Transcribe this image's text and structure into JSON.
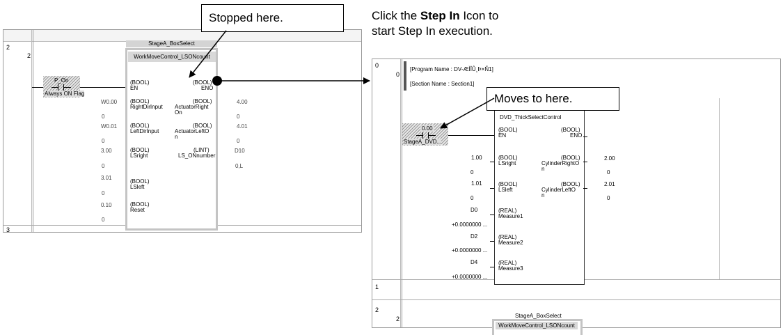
{
  "callouts": {
    "stopped": "Stopped here.",
    "moves": "Moves to here.",
    "instruction_line1_pre": "Click the ",
    "instruction_line1_bold": "Step In",
    "instruction_line1_post": " Icon to",
    "instruction_line2": "start Step In execution."
  },
  "left_panel": {
    "rung_num_outer": "2",
    "rung_num_inner": "2",
    "rung_next": "3",
    "fb_instance": "StageA_BoxSelect",
    "fb_name": "WorkMoveControl_LSONcount",
    "contact_label": "P_On",
    "contact_comment": "Always ON Flag",
    "en_type": "(BOOL)",
    "en_name": "EN",
    "eno_type": "(BOOL)",
    "eno_name": "ENO",
    "inputs": [
      {
        "addr": "W0.00",
        "val": "0",
        "type": "(BOOL)",
        "name": "RightDirInput"
      },
      {
        "addr": "W0.01",
        "val": "0",
        "type": "(BOOL)",
        "name": "LeftDirInput"
      },
      {
        "addr": "3.00",
        "val": "0",
        "type": "(BOOL)",
        "name": "LSright"
      },
      {
        "addr": "3.01",
        "val": "0",
        "type": "(BOOL)",
        "name": "LSleft"
      },
      {
        "addr": "0.10",
        "val": "0",
        "type": "(BOOL)",
        "name": "Reset"
      }
    ],
    "outputs": [
      {
        "type": "(BOOL)",
        "name1": "ActuatorRight",
        "name2": "On",
        "addr": "4.00",
        "val": "0"
      },
      {
        "type": "(BOOL)",
        "name1": "ActuatorLeftO",
        "name2": "n",
        "addr": "4.01",
        "val": "0"
      },
      {
        "type": "(LINT)",
        "name1": "LS_ONnumber",
        "name2": "",
        "addr": "D10",
        "val": "0,L"
      }
    ]
  },
  "right_panel": {
    "row0_outer": "0",
    "row0_inner": "0",
    "program_name": "[Program Name : DV-ÆÌÎÛ¸Þ×Ñ1]",
    "section_name": "[Section Name : Section1]",
    "fb_name": "DVD_ThickSelectControl",
    "contact_addr": "0.00",
    "contact_comment": "StageA_DVD...",
    "en_type": "(BOOL)",
    "en_name": "EN",
    "eno_type": "(BOOL)",
    "eno_name": "ENO",
    "inputs": [
      {
        "addr": "1.00",
        "val": "0",
        "type": "(BOOL)",
        "name": "LSright"
      },
      {
        "addr": "1.01",
        "val": "0",
        "type": "(BOOL)",
        "name": "LSleft"
      },
      {
        "addr": "D0",
        "val": "+0.0000000 ...",
        "type": "(REAL)",
        "name": "Measure1"
      },
      {
        "addr": "D2",
        "val": "+0.0000000 ...",
        "type": "(REAL)",
        "name": "Measure2"
      },
      {
        "addr": "D4",
        "val": "+0.0000000 ...",
        "type": "(REAL)",
        "name": "Measure3"
      }
    ],
    "outputs": [
      {
        "type": "(BOOL)",
        "name1": "CylinderRightO",
        "name2": "n",
        "addr": "2.00",
        "val": "0"
      },
      {
        "type": "(BOOL)",
        "name1": "CylinderLeftO",
        "name2": "n",
        "addr": "2.01",
        "val": "0"
      }
    ],
    "row1": "1",
    "row2_outer": "2",
    "row2_inner": "2",
    "fb2_instance": "StageA_BoxSelect",
    "fb2_name": "WorkMoveControl_LSONcount"
  }
}
